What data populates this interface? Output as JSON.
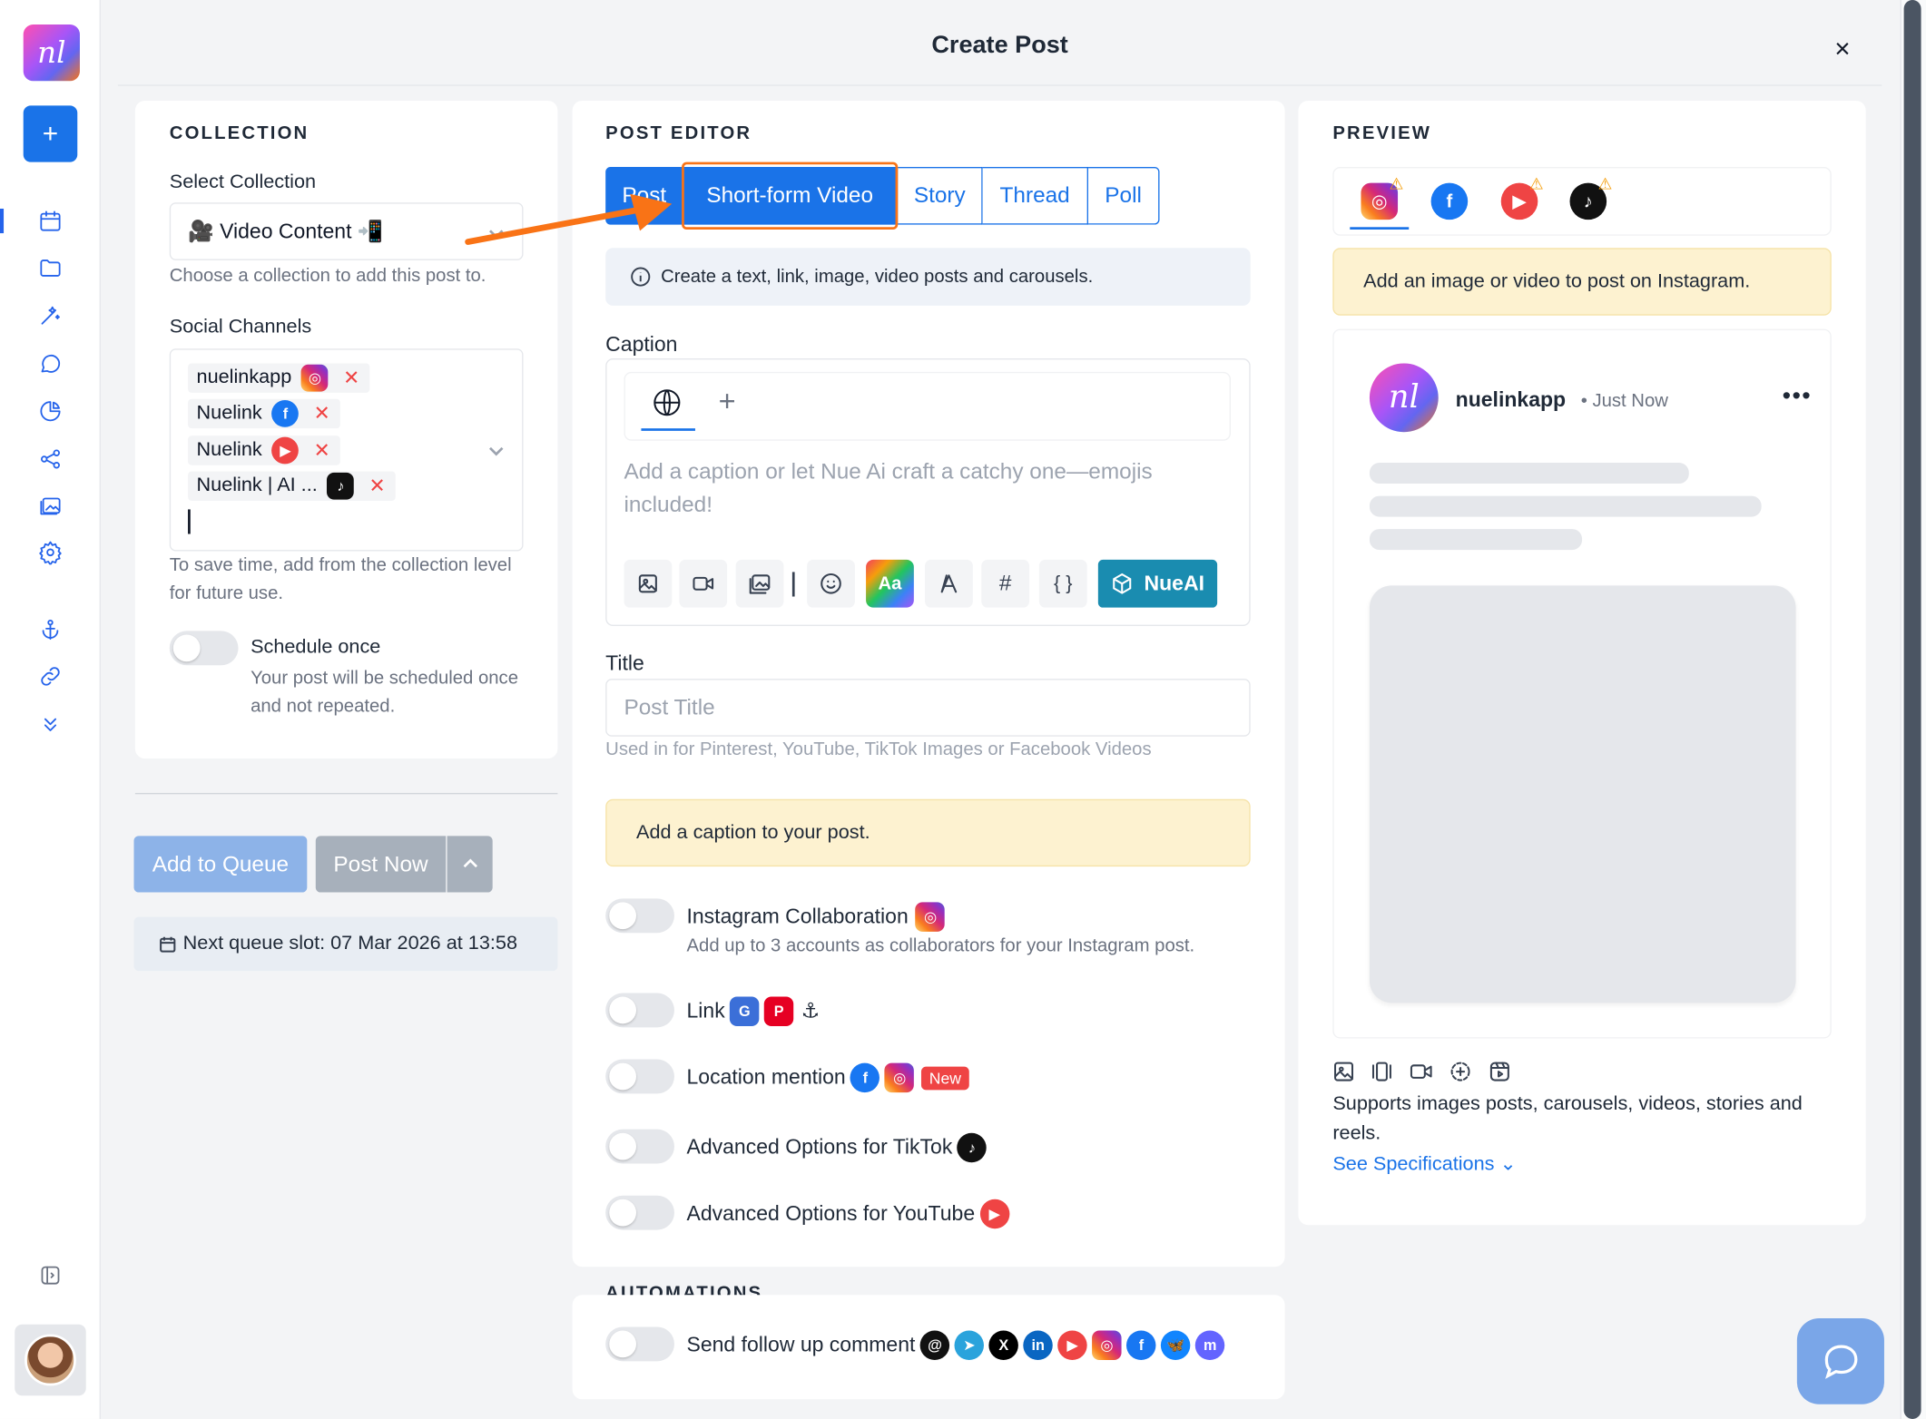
{
  "modal": {
    "title": "Create Post",
    "close_icon": "×"
  },
  "rail": {
    "logo_text": "nl",
    "add_label": "+"
  },
  "collection": {
    "section_title": "COLLECTION",
    "select_label": "Select Collection",
    "selected_value": "🎥 Video Content 📲",
    "select_help": "Choose a collection to add this post to.",
    "channels_label": "Social Channels",
    "channels": [
      {
        "name": "nuelinkapp",
        "network": "instagram"
      },
      {
        "name": "Nuelink",
        "network": "facebook"
      },
      {
        "name": "Nuelink",
        "network": "youtube"
      },
      {
        "name": "Nuelink | AI ...",
        "network": "tiktok"
      }
    ],
    "channels_help": "To save time, add from the collection level for future use.",
    "schedule_once_label": "Schedule once",
    "schedule_once_help": "Your post will be scheduled once and not repeated."
  },
  "actions": {
    "add_to_queue": "Add to Queue",
    "post_now": "Post Now",
    "next_slot": "Next queue slot: 07 Mar 2026 at 13:58"
  },
  "editor": {
    "section_title": "POST EDITOR",
    "tabs": [
      {
        "label": "Post",
        "active": false
      },
      {
        "label": "Short-form Video",
        "active": true
      },
      {
        "label": "Story",
        "active": false
      },
      {
        "label": "Thread",
        "active": false
      },
      {
        "label": "Poll",
        "active": false
      }
    ],
    "info": "Create a text, link, image, video posts and carousels.",
    "caption_label": "Caption",
    "caption_placeholder": "Add a caption or let Nue Ai craft a catchy one—emojis included!",
    "caption_add": "+",
    "toolbar": {
      "aa_label": "Aa",
      "hashtag_label": "#",
      "braces_label": "{ }",
      "nueai_label": "NueAI"
    },
    "title_label": "Title",
    "title_placeholder": "Post Title",
    "title_help": "Used in for Pinterest, YouTube, TikTok Images or Facebook Videos",
    "caption_warning": "Add a caption to your post.",
    "options": {
      "collab_label": "Instagram Collaboration",
      "collab_help": "Add up to 3 accounts as collaborators for your Instagram post.",
      "link_label": "Link",
      "location_label": "Location mention",
      "new_badge": "New",
      "tiktok_label": "Advanced Options for TikTok",
      "youtube_label": "Advanced Options for YouTube"
    },
    "automations_title": "AUTOMATIONS",
    "follow_up_label": "Send follow up comment"
  },
  "preview": {
    "section_title": "PREVIEW",
    "warning": "Add an image or video to post on Instagram.",
    "account_name": "nuelinkapp",
    "time": "• Just Now",
    "more": "•••",
    "avatar_text": "nl",
    "supports": "Supports images posts, carousels, videos, stories and reels.",
    "see_specs": "See Specifications ⌄"
  },
  "colors": {
    "primary": "#1a73e8",
    "highlight": "#f97316",
    "warning_bg": "#fdf2d0"
  }
}
